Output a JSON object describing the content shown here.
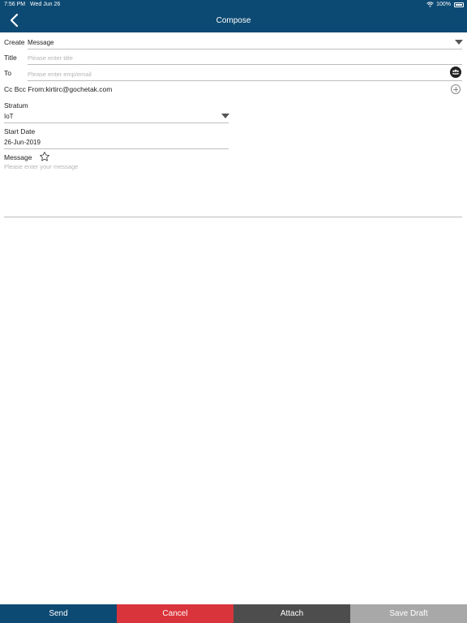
{
  "status_bar": {
    "time": "7:56 PM",
    "date": "Wed Jun 26",
    "battery": "100%"
  },
  "header": {
    "title": "Compose"
  },
  "form": {
    "create": {
      "label": "Create",
      "value": "Message"
    },
    "title": {
      "label": "Title",
      "placeholder": "Please enter title"
    },
    "to": {
      "label": "To",
      "placeholder": "Please enter emp/email"
    },
    "cc_bcc": {
      "cc": "Cc",
      "bcc": "Bcc",
      "from": "From:kirtirc@gochetak.com"
    },
    "stratum": {
      "label": "Stratum",
      "value": "IoT"
    },
    "start_date": {
      "label": "Start Date",
      "value": "26-Jun-2019"
    },
    "message": {
      "label": "Message",
      "placeholder": "Please enter your message"
    }
  },
  "actions": {
    "send": "Send",
    "cancel": "Cancel",
    "attach": "Attach",
    "save_draft": "Save Draft"
  },
  "colors": {
    "primary": "#0d4a73",
    "cancel": "#d9343b",
    "attach": "#4d4d4d",
    "draft": "#a8a8a8"
  },
  "icons": [
    "back-chevron-icon",
    "wifi-icon",
    "battery-icon",
    "dropdown-caret-icon",
    "contacts-icon",
    "add-circle-icon",
    "star-icon"
  ]
}
